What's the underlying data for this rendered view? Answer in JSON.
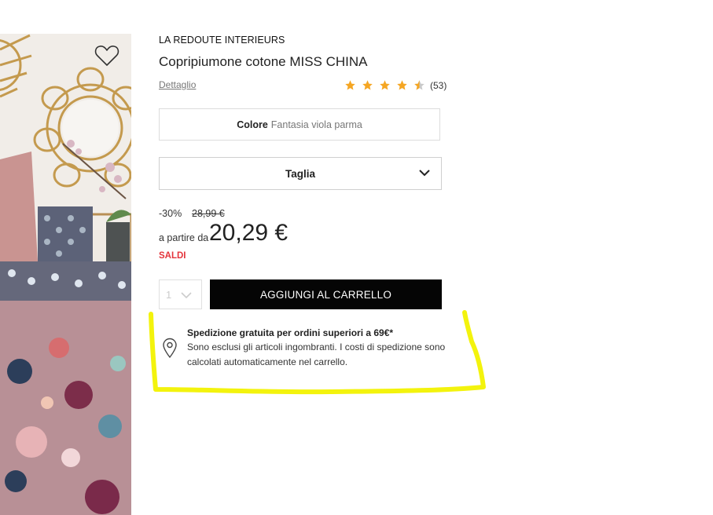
{
  "product": {
    "brand": "LA REDOUTE INTERIEURS",
    "title": "Copripiumone cotone MISS CHINA",
    "detail_link": "Dettaglio",
    "rating": {
      "stars": 4.5,
      "count": "(53)"
    },
    "color": {
      "label": "Colore",
      "value": "Fantasia viola parma"
    },
    "size": {
      "label": "Taglia"
    }
  },
  "pricing": {
    "discount": "-30%",
    "old_price": "28,99 €",
    "from_label": "a partire da",
    "price": "20,29 €",
    "sale_badge": "SALDI"
  },
  "cart": {
    "quantity": "1",
    "add_button": "AGGIUNGI AL CARRELLO"
  },
  "shipping": {
    "title": "Spedizione gratuita per ordini superiori a 69€*",
    "description": "Sono esclusi gli articoli ingombranti. I costi di spedizione sono calcolati automaticamente nel carrello."
  },
  "icons": {
    "wishlist": "heart-icon",
    "star": "star-icon",
    "size_dropdown": "chevron-down-icon",
    "location": "location-pin-icon"
  },
  "colors": {
    "star": "#f5a623",
    "sale": "#e4343b",
    "button_bg": "#050505",
    "highlight": "#f2f200"
  }
}
